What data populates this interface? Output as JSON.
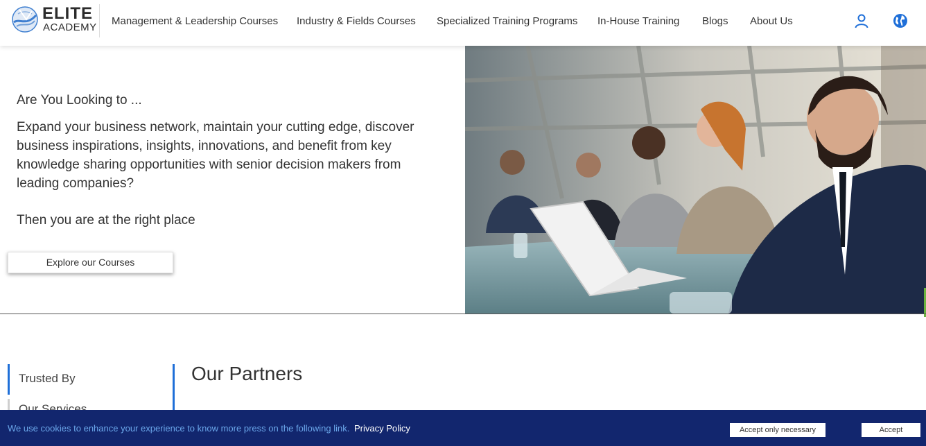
{
  "brand": {
    "name_top": "ELITE",
    "name_bottom": "ACADEMY",
    "logo_icon": "globe-swoosh-logo",
    "colors": {
      "logo_blue": "#3f7fd0",
      "text": "#2b2b2b"
    }
  },
  "nav": {
    "items": [
      {
        "label": "Management & Leadership Courses"
      },
      {
        "label": "Industry & Fields Courses"
      },
      {
        "label": "Specialized Training Programs"
      },
      {
        "label": "In-House Training"
      },
      {
        "label": "Blogs"
      },
      {
        "label": "About Us"
      }
    ],
    "icons": [
      "user-icon",
      "globe-icon"
    ],
    "icon_color": "#1f6fd8"
  },
  "hero": {
    "kicker": "Are You Looking to ...",
    "body": "Expand your business network, maintain your cutting edge, discover business inspirations, insights, innovations, and benefit from key knowledge sharing opportunities with senior decision makers from leading companies?",
    "cta_text": "Then you are at the right place",
    "button_label": "Explore our Courses",
    "image": "business-meeting-photo"
  },
  "section": {
    "tabs": [
      {
        "label": "Trusted By"
      },
      {
        "label": "Our Services"
      }
    ],
    "title": "Our Partners",
    "accent": "#1f6fd8"
  },
  "cookie": {
    "message": "We use cookies to enhance your experience to know more press on the following link.",
    "link": "Privacy Policy",
    "accept_necessary": "Accept only necessary",
    "accept": "Accept",
    "colors": {
      "background": "#12266e",
      "message": "#6ba7ea"
    }
  }
}
